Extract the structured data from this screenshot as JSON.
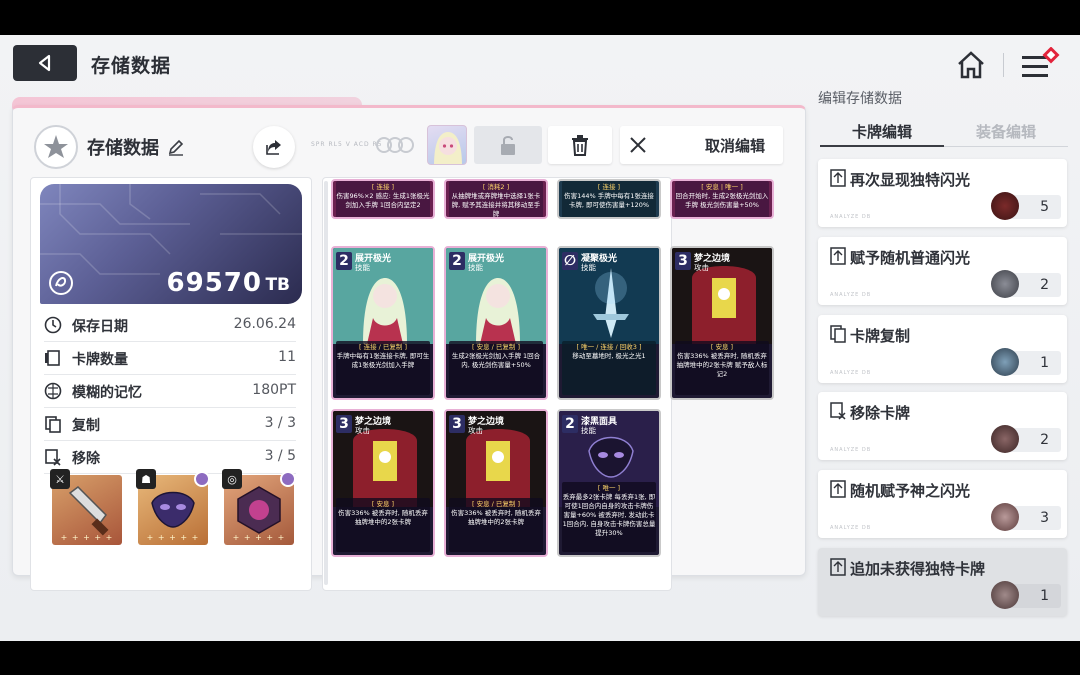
{
  "header": {
    "title": "存储数据"
  },
  "save": {
    "label": "存储数据",
    "tiny_text": "SPR RL5 V ACD R5",
    "cancel_label": "取消编辑",
    "tb_value": "69570",
    "tb_unit": "TB"
  },
  "stats": [
    {
      "label": "保存日期",
      "value": "26.06.24",
      "icon": "clock-icon"
    },
    {
      "label": "卡牌数量",
      "value": "11",
      "icon": "card-icon"
    },
    {
      "label": "模糊的记忆",
      "value": "180PT",
      "icon": "brain-icon"
    },
    {
      "label": "复制",
      "value": "3 / 3",
      "icon": "copy-icon"
    },
    {
      "label": "移除",
      "value": "3 / 5",
      "icon": "remove-icon"
    }
  ],
  "relics": [
    {
      "stars": "+ + + + +",
      "badge": "knife"
    },
    {
      "stars": "+ + + + +",
      "badge": "mask"
    },
    {
      "stars": "+ + + + +",
      "badge": "ring"
    }
  ],
  "cards_top": [
    {
      "tag": "[ 连接 ]",
      "text": "伤害96%×2 感应: 生成1张极光剑加入手牌 1回合内坚定2"
    },
    {
      "tag": "[ 消耗2 ]",
      "text": "从抽牌堆或弃牌堆中选择1张卡牌, 赋予其连接并将其移动至手牌"
    },
    {
      "tag": "[ 连接 ]",
      "text": "伤害144% 手牌中每有1张连接卡牌, 即可使伤害量+120%"
    },
    {
      "tag": "[ 安息 | 唯一 ]",
      "text": "回合开始时, 生成2张极光剑加入手牌 极光剑伤害量+50%"
    }
  ],
  "cards": [
    {
      "cost": "2",
      "name": "展开极光",
      "type": "技能",
      "tag": "[ 连接 / 已复制 ]",
      "text": "手牌中每有1张连接卡牌, 即可生成1张极光剑加入手牌"
    },
    {
      "cost": "2",
      "name": "展开极光",
      "type": "技能",
      "tag": "[ 安息 / 已复制 ]",
      "text": "生成2张极光剑加入手牌 1回合内, 极光剑伤害量+50%"
    },
    {
      "cost": "∅",
      "name": "凝聚极光",
      "type": "技能",
      "tag": "[ 唯一 / 连接 / 回收3 ]",
      "text": "移动至墓地时, 极光之光1"
    },
    {
      "cost": "3",
      "name": "梦之边境",
      "type": "攻击",
      "tag": "[ 安息 ]",
      "text": "伤害336% 被丢弃时, 随机丢弃抽牌堆中的2张卡牌 赋予敌人标记2"
    },
    {
      "cost": "3",
      "name": "梦之边境",
      "type": "攻击",
      "tag": "[ 安息 ]",
      "text": "伤害336% 被丢弃时, 随机丢弃抽牌堆中的2张卡牌"
    },
    {
      "cost": "3",
      "name": "梦之边境",
      "type": "攻击",
      "tag": "[ 安息 / 已复制 ]",
      "text": "伤害336% 被丢弃时, 随机丢弃抽牌堆中的2张卡牌"
    },
    {
      "cost": "2",
      "name": "漆黑面具",
      "type": "技能",
      "tag": "[ 唯一 ]",
      "text": "丢弃最多2张卡牌 每丢弃1张, 即可使1回合内自身的攻击卡牌伤害量+60% 被丢弃时, 发动此卡 1回合内, 自身攻击卡牌伤害总量提升30%"
    }
  ],
  "right_panel": {
    "header": "编辑存储数据",
    "tab_active": "卡牌编辑",
    "tab_inactive": "装备编辑",
    "options": [
      {
        "label": "再次显现独特闪光",
        "count": "5",
        "icon": "sparkle-card-icon"
      },
      {
        "label": "赋予随机普通闪光",
        "count": "2",
        "icon": "sparkle-card-icon"
      },
      {
        "label": "卡牌复制",
        "count": "1",
        "icon": "copy-card-icon"
      },
      {
        "label": "移除卡牌",
        "count": "2",
        "icon": "remove-card-icon"
      },
      {
        "label": "随机赋予神之闪光",
        "count": "3",
        "icon": "sparkle-card-icon"
      },
      {
        "label": "追加未获得独特卡牌",
        "count": "1",
        "icon": "sparkle-card-icon"
      }
    ],
    "option_tiny": "ANALYZE DB"
  },
  "colors": {
    "accent_pink": "#f3b9cb",
    "dark": "#2c2f36",
    "menu_badge": "#e2233b"
  }
}
